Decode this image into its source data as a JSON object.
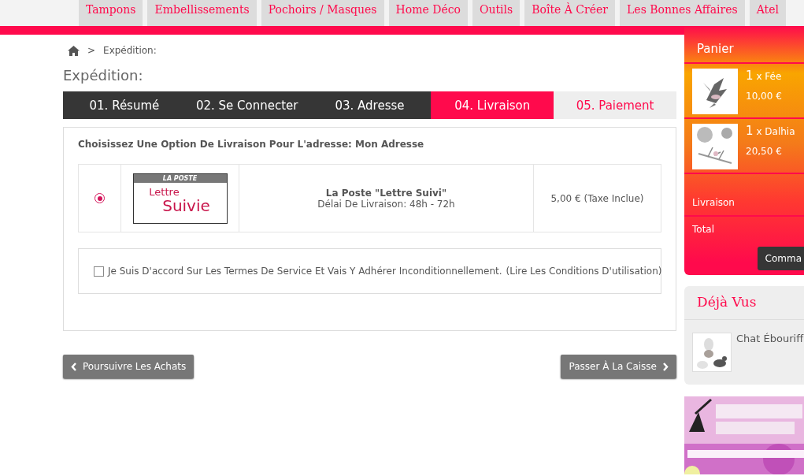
{
  "nav": {
    "items": [
      {
        "label": "Tampons"
      },
      {
        "label": "Embellissements"
      },
      {
        "label": "Pochoirs / Masques"
      },
      {
        "label": "Home Déco"
      },
      {
        "label": "Outils"
      },
      {
        "label": "Boîte À Créer"
      },
      {
        "label": "Les Bonnes Affaires"
      },
      {
        "label": "Atel"
      }
    ]
  },
  "breadcrumb": {
    "separator": ">",
    "current": "Expédition:"
  },
  "title": "Expédition:",
  "steps": [
    {
      "label": "01. Résumé",
      "kind": "done"
    },
    {
      "label": "02. Se Connecter",
      "kind": "done"
    },
    {
      "label": "03. Adresse",
      "kind": "done"
    },
    {
      "label": "04. Livraison",
      "kind": "current"
    },
    {
      "label": "05. Paiement",
      "kind": "upcoming"
    }
  ],
  "delivery": {
    "heading": "Choisissez Une Option De Livraison Pour L'adresse: Mon Adresse",
    "options": [
      {
        "selected": true,
        "logo": {
          "top": "LA POSTE",
          "line1": "Lettre",
          "line2": "Suivie"
        },
        "name": "La Poste \"Lettre Suivi\"",
        "delay": "Délai De Livraison: 48h - 72h",
        "price": "5,00 € (Taxe Inclue)"
      }
    ],
    "terms": {
      "checked": false,
      "text": "Je Suis D'accord Sur Les Termes De Service Et Vais Y Adhérer Inconditionnellement.",
      "link": "(Lire Les Conditions D'utilisation)"
    }
  },
  "buttons": {
    "back": "Poursuivre Les Achats",
    "next": "Passer À La Caisse"
  },
  "cart": {
    "title": "Panier",
    "items": [
      {
        "kind": "picture",
        "qty": "1",
        "times": "x",
        "name": "Fée",
        "price": "10,00 €"
      },
      {
        "kind": "picture",
        "qty": "1",
        "times": "x",
        "name": "Dalhia",
        "price": "20,50 €"
      }
    ],
    "shipping_label": "Livraison",
    "total_label": "Total",
    "order_button": "Comma"
  },
  "viewed": {
    "title": "Déjà Vus",
    "items": [
      {
        "kind": "picture",
        "name": "Chat Ébouriff"
      }
    ]
  }
}
